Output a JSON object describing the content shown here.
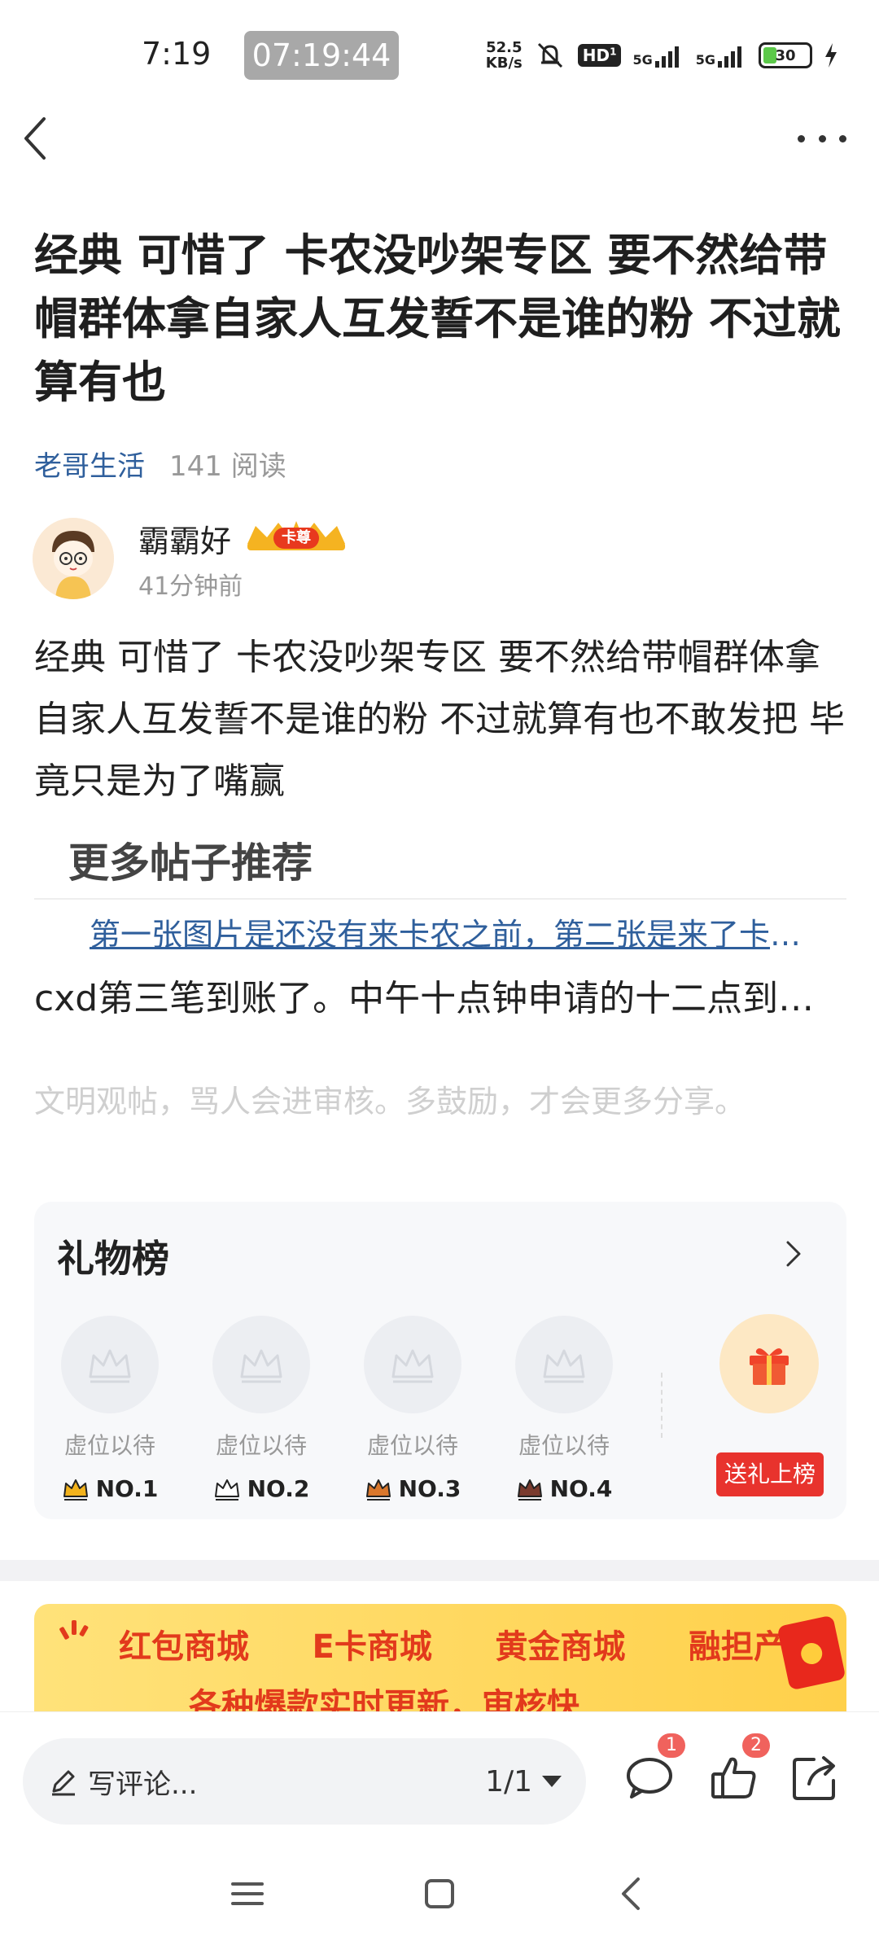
{
  "status_bar": {
    "time": "7:19",
    "clock_overlay": "07:19:44",
    "net_speed_value": "52.5",
    "net_speed_unit": "KB/s",
    "hd_label": "HD",
    "hd_sub": "1",
    "network_1": "5G",
    "network_2": "5G",
    "battery": "30",
    "battery_level_percent": 30
  },
  "icons": {
    "back": "back-arrow-icon",
    "more": "more-dots-icon",
    "mute": "bell-muted-icon",
    "charging": "lightning-icon"
  },
  "post": {
    "title": "经典 可惜了 卡农没吵架专区 要不然给带帽群体拿自家人互发誓不是谁的粉 不过就算有也",
    "forum": "老哥生活",
    "reads": "141 阅读",
    "author_name": "霸霸好",
    "author_badge": "卡尊",
    "post_time": "41分钟前",
    "body": "经典 可惜了 卡农没吵架专区 要不然给带帽群体拿自家人互发誓不是谁的粉 不过就算有也不敢发把 毕竟只是为了嘴赢"
  },
  "recommend": {
    "heading": "更多帖子推荐",
    "link_text": "第一张图片是还没有来卡农之前，第二张是来了卡农之后",
    "post_text": "cxd第三笔到账了。中午十点钟申请的十二点到账了"
  },
  "civil_note": "文明观帖，骂人会进审核。多鼓励，才会更多分享。",
  "gift_list": {
    "title": "礼物榜",
    "slots": [
      {
        "label": "虚位以待",
        "rank": "NO.1",
        "crown_color": "#f2b21c"
      },
      {
        "label": "虚位以待",
        "rank": "NO.2",
        "crown_color": "#9aa3b2"
      },
      {
        "label": "虚位以待",
        "rank": "NO.3",
        "crown_color": "#d9772c"
      },
      {
        "label": "虚位以待",
        "rank": "NO.4",
        "crown_color": "#7a3b2e"
      }
    ],
    "send_button": "送礼上榜"
  },
  "banner": {
    "items": [
      "红包商城",
      "E卡商城",
      "黄金商城",
      "融担产品"
    ],
    "line2": "各种爆款实时更新，审核快"
  },
  "bottom_bar": {
    "comment_placeholder": "写评论...",
    "page_indicator": "1/1",
    "comment_count": "1",
    "like_count": "2"
  },
  "colors": {
    "link_blue": "#2f5f9c",
    "accent_red": "#e8332d",
    "badge_red": "#f0625d"
  }
}
